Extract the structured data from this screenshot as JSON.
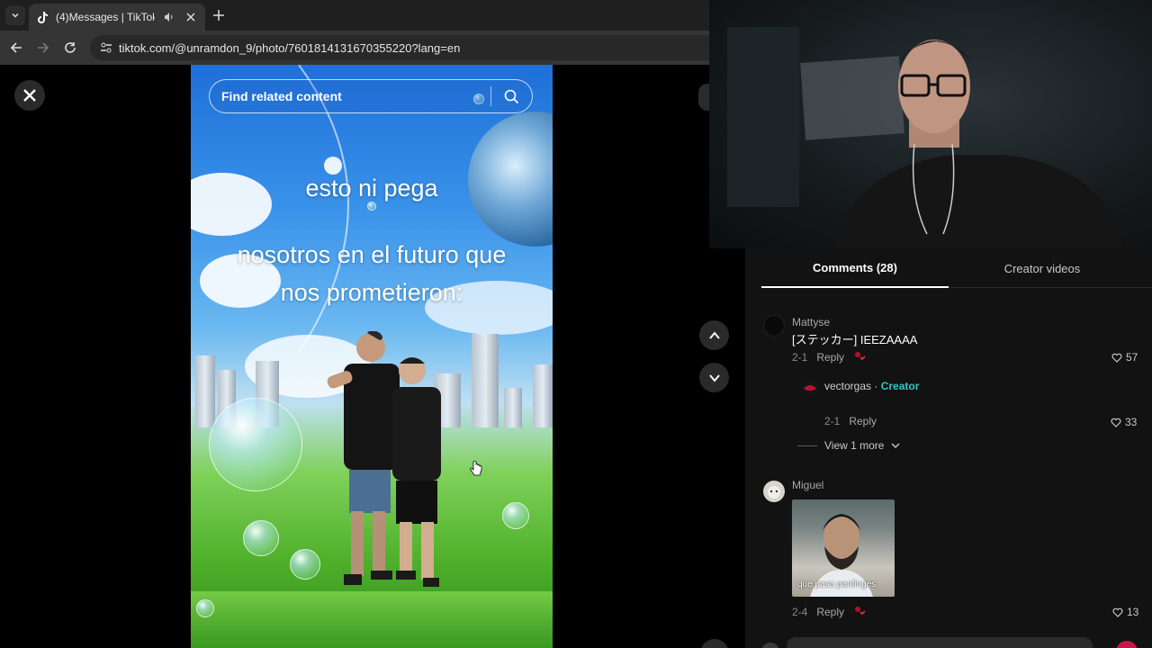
{
  "browser": {
    "tab_title": "(4)Messages | TikTok",
    "url": "tiktok.com/@unramdon_9/photo/7601814131670355220?lang=en"
  },
  "photo": {
    "search_placeholder": "Find related content",
    "overlay_line1": "esto ni pega",
    "overlay_line2": "nosotros en el futuro que",
    "overlay_line3": "nos prometieron:"
  },
  "comments_panel": {
    "tab_comments": "Comments (28)",
    "tab_creator_videos": "Creator videos",
    "comments": [
      {
        "user": "Mattyse",
        "text": "[ステッカー] IEEZAAAA",
        "date": "2-1",
        "reply_label": "Reply",
        "likes": "57"
      },
      {
        "user": "vectorgas",
        "creator_sep": " · ",
        "creator_label": "Creator",
        "date": "2-1",
        "reply_label": "Reply",
        "likes": "33"
      },
      {
        "user": "Miguel",
        "sticker_caption": "que pasa panfinges",
        "date": "2-4",
        "reply_label": "Reply",
        "likes": "13"
      }
    ],
    "view_more": "View 1 more"
  },
  "colors": {
    "creator_accent": "#2fc6c9",
    "panel_bg": "#121212",
    "like_red": "#e5304f"
  }
}
